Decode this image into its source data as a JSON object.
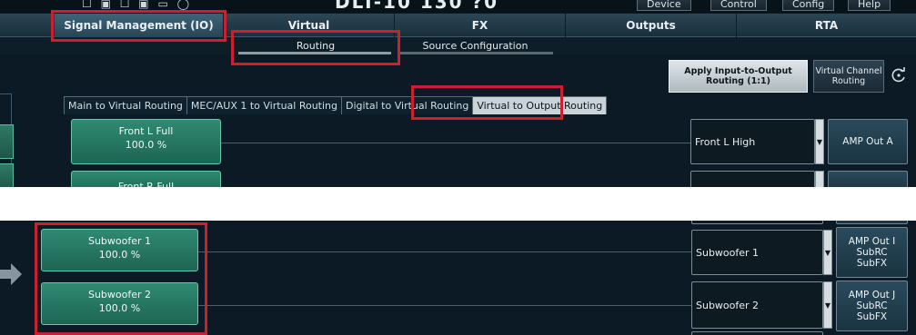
{
  "header": {
    "title_glyphs": "☐ ▣ ☐ ▣ ▭ ◯",
    "title": "DLT-10 130 ?0",
    "top_buttons": [
      "Device",
      "Control",
      "Config",
      "Help"
    ]
  },
  "main_tabs": [
    {
      "label": "Signal Management (IO)",
      "active": true
    },
    {
      "label": "Virtual",
      "active": false
    },
    {
      "label": "FX",
      "active": false
    },
    {
      "label": "Outputs",
      "active": false
    },
    {
      "label": "RTA",
      "active": false
    }
  ],
  "sub_tabs": [
    {
      "label": "Routing",
      "active": true
    },
    {
      "label": "Source Configuration",
      "active": false
    }
  ],
  "actions": {
    "apply_routing": "Apply Input-to-Output Routing (1:1)",
    "virtual_channel_routing": "Virtual Channel Routing",
    "reset_icon": "refresh-icon"
  },
  "routing_tabs": [
    {
      "label": "Main to Virtual Routing",
      "active": false
    },
    {
      "label": "MEC/AUX 1 to Virtual Routing",
      "active": false
    },
    {
      "label": "Digital to Virtual Routing",
      "active": false
    },
    {
      "label": "Virtual to Output Routing",
      "active": true
    }
  ],
  "top_rows": [
    {
      "source": "Front L Full",
      "level": "100.0 %",
      "output": "Front L High",
      "target": "AMP Out A"
    },
    {
      "source": "Front R Full",
      "level": "",
      "output": "",
      "target": ""
    }
  ],
  "bottom_rows": [
    {
      "source": "Subwoofer 1",
      "level": "100.0 %",
      "output": "Subwoofer 1",
      "target_lines": [
        "AMP Out I",
        "SubRC",
        "SubFX"
      ]
    },
    {
      "source": "Subwoofer 2",
      "level": "100.0 %",
      "output": "Subwoofer 2",
      "target_lines": [
        "AMP Out J",
        "SubRC",
        "SubFX"
      ]
    }
  ],
  "colors": {
    "highlight": "#cc2030",
    "background": "#0b1a24",
    "source_button": "#2f8a72",
    "active_tab": "#3e6478"
  }
}
